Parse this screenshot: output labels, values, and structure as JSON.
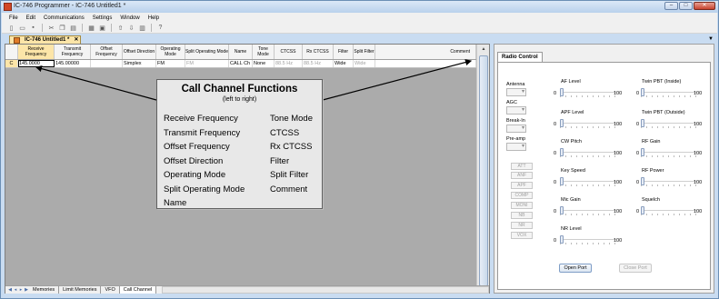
{
  "window": {
    "title": "IC-746 Programmer - IC-746 Untitled1 *"
  },
  "menu": [
    "File",
    "Edit",
    "Communications",
    "Settings",
    "Window",
    "Help"
  ],
  "toolbar": {
    "icons": [
      "new-file-icon",
      "open-folder-icon",
      "save-icon",
      "cut-icon",
      "copy-icon",
      "paste-icon",
      "print-icon",
      "print-preview-icon",
      "read-radio-icon",
      "write-radio-icon",
      "monitor-icon",
      "help-icon"
    ]
  },
  "doc_tab": {
    "label": "IC-746 Untitled1 *"
  },
  "grid": {
    "headers": [
      "Receive Frequency",
      "Transmit Frequency",
      "Offset Frequency",
      "Offset Direction",
      "Operating Mode",
      "Split Operating Mode",
      "Name",
      "Tone Mode",
      "CTCSS",
      "Rx CTCSS",
      "Filter",
      "Split Filter",
      "Comment"
    ],
    "row_header": "C",
    "row": [
      "145.0000",
      "145.00000",
      "",
      "Simplex",
      "FM",
      "FM",
      "CALL Ch",
      "None",
      "88.5 Hz",
      "88.5 Hz",
      "Wide",
      "Wide",
      ""
    ]
  },
  "sheet_tabs": [
    "Memories",
    "Limit Memories",
    "VFO",
    "Call Channel"
  ],
  "callout": {
    "title": "Call Channel Functions",
    "subtitle": "(left to right)",
    "left": [
      "Receive Frequency",
      "Transmit Frequency",
      "Offset Frequency",
      "Offset Direction",
      "Operating Mode",
      "Split Operating Mode",
      "Name"
    ],
    "right": [
      "Tone Mode",
      "CTCSS",
      "Rx CTCSS",
      "Filter",
      "Split Filter",
      "Comment"
    ]
  },
  "radio": {
    "tab": "Radio Control",
    "combos": [
      "Antenna",
      "AGC",
      "Break-In",
      "Pre-amp"
    ],
    "buttons": [
      "ATT",
      "ANF",
      "APF",
      "COMP",
      "MONI",
      "NB",
      "NR",
      "VOX"
    ],
    "sliders_left": [
      {
        "label": "AF Level",
        "min": "0",
        "max": "100",
        "value": 0
      },
      {
        "label": "APF Level",
        "min": "0",
        "max": "100",
        "value": 0
      },
      {
        "label": "CW Pitch",
        "min": "0",
        "max": "100",
        "value": 0
      },
      {
        "label": "Key Speed",
        "min": "0",
        "max": "100",
        "value": 0
      },
      {
        "label": "Mic Gain",
        "min": "0",
        "max": "100",
        "value": 0
      },
      {
        "label": "NR Level",
        "min": "0",
        "max": "100",
        "value": 0
      }
    ],
    "sliders_right": [
      {
        "label": "Twin PBT (Inside)",
        "min": "0",
        "max": "100",
        "value": 0
      },
      {
        "label": "Twin PBT (Outside)",
        "min": "0",
        "max": "100",
        "value": 0
      },
      {
        "label": "RF Gain",
        "min": "0",
        "max": "100",
        "value": 0
      },
      {
        "label": "RF Power",
        "min": "0",
        "max": "100",
        "value": 0
      },
      {
        "label": "Squelch",
        "min": "0",
        "max": "100",
        "value": 0
      }
    ],
    "open_port": "Open Port",
    "close_port": "Close Port"
  }
}
